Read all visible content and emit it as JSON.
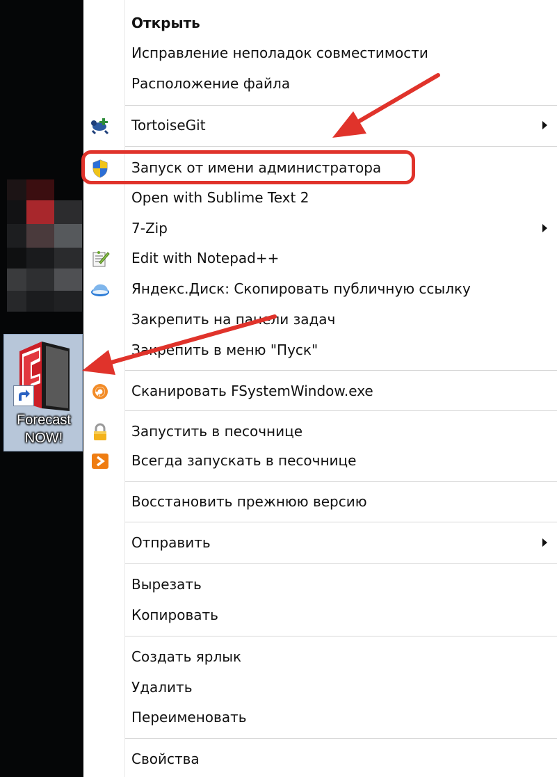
{
  "desktop": {
    "shortcut_label_line1": "Forecast",
    "shortcut_label_line2": "NOW!"
  },
  "menu": {
    "items": [
      {
        "label": "Открыть",
        "bold": true
      },
      {
        "label": "Исправление неполадок совместимости"
      },
      {
        "label": "Расположение файла"
      },
      {
        "label": "TortoiseGit",
        "icon": "tortoisegit-icon",
        "submenu": true
      },
      {
        "label": "Запуск от имени администратора",
        "icon": "uac-shield-icon"
      },
      {
        "label": "Open with Sublime Text 2"
      },
      {
        "label": "7-Zip",
        "submenu": true
      },
      {
        "label": "Edit with Notepad++",
        "icon": "notepad-plus-plus-icon"
      },
      {
        "label": "Яндекс.Диск: Скопировать публичную ссылку",
        "icon": "yandex-disk-icon"
      },
      {
        "label": "Закрепить на панели задач"
      },
      {
        "label": "Закрепить в меню \"Пуск\""
      },
      {
        "label": "Сканировать FSystemWindow.exe",
        "icon": "antivirus-scan-icon"
      },
      {
        "label": "Запустить в песочнице",
        "icon": "sandbox-lock-icon"
      },
      {
        "label": "Всегда запускать в песочнице",
        "icon": "sandbox-arrow-icon"
      },
      {
        "label": "Восстановить прежнюю версию"
      },
      {
        "label": "Отправить",
        "submenu": true
      },
      {
        "label": "Вырезать"
      },
      {
        "label": "Копировать"
      },
      {
        "label": "Создать ярлык"
      },
      {
        "label": "Удалить"
      },
      {
        "label": "Переименовать"
      },
      {
        "label": "Свойства"
      }
    ]
  },
  "colors": {
    "annotation_red": "#e0332b",
    "menu_text": "#111111",
    "separator": "#d7d7d7"
  }
}
